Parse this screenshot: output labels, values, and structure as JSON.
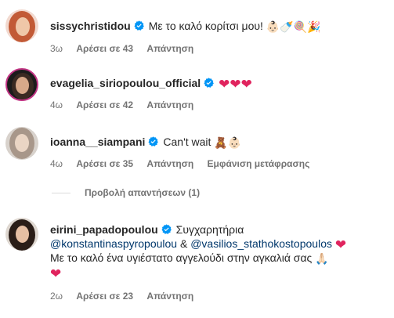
{
  "comments": [
    {
      "username": "sissychristidou",
      "text": "Με το καλό κορίτσι μου!",
      "emojis": [
        "👶🏻",
        "🍼",
        "🍭",
        "🎉"
      ],
      "time": "3ω",
      "likes": "Αρέσει σε 43",
      "reply": "Απάντηση"
    },
    {
      "username": "evagelia_siriopoulou_official",
      "text": "",
      "hearts": [
        "❤",
        "❤",
        "❤"
      ],
      "time": "4ω",
      "likes": "Αρέσει σε 42",
      "reply": "Απάντηση"
    },
    {
      "username": "ioanna__siampani",
      "text": "Can't wait",
      "emojis": [
        "🧸",
        "👶🏻"
      ],
      "time": "4ω",
      "likes": "Αρέσει σε 35",
      "reply": "Απάντηση",
      "translate": "Εμφάνιση μετάφρασης"
    },
    {
      "username": "eirini_papadopoulou",
      "text": "Συγχαρητήρια",
      "mention1": "@konstantinaspyropoulou",
      "amp": "&",
      "mention2": "@vasilios_stathokostopoulos",
      "line3": "Με το καλό ένα υγιέστατο αγγελούδι στην αγκαλιά σας",
      "pray": "🙏🏻",
      "heart": "❤",
      "time": "2ω",
      "likes": "Αρέσει σε 23",
      "reply": "Απάντηση"
    }
  ],
  "view_replies": "Προβολή απαντήσεων (1)",
  "colors": {
    "verified": "#0095f6",
    "heart": "#e0245e",
    "meta": "#737373",
    "mention": "#00376b"
  }
}
